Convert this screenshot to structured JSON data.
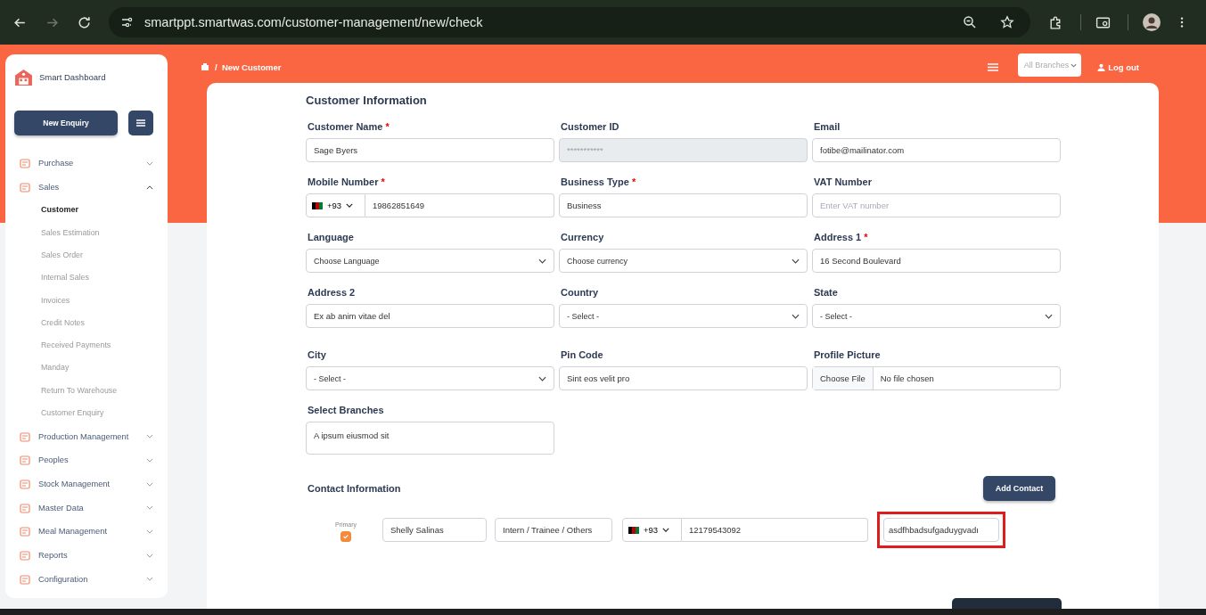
{
  "browser": {
    "url": "smartppt.smartwas.com/customer-management/new/check",
    "forward_disabled": true
  },
  "sidebar": {
    "brand": "Smart Dashboard",
    "primary_button": "New Enquiry",
    "items": [
      {
        "label": "Purchase",
        "expanded": false
      },
      {
        "label": "Sales",
        "expanded": true,
        "children": [
          {
            "label": "Customer",
            "selected": true
          },
          {
            "label": "Sales Estimation",
            "selected": false
          },
          {
            "label": "Sales Order",
            "selected": false
          },
          {
            "label": "Internal Sales",
            "selected": false
          },
          {
            "label": "Invoices",
            "selected": false
          },
          {
            "label": "Credit Notes",
            "selected": false
          },
          {
            "label": "Received Payments",
            "selected": false
          },
          {
            "label": "Manday",
            "selected": false
          },
          {
            "label": "Return To Warehouse",
            "selected": false
          },
          {
            "label": "Customer Enquiry",
            "selected": false
          }
        ]
      },
      {
        "label": "Production Management",
        "expanded": false
      },
      {
        "label": "Peoples",
        "expanded": false
      },
      {
        "label": "Stock Management",
        "expanded": false
      },
      {
        "label": "Master Data",
        "expanded": false
      },
      {
        "label": "Meal Management",
        "expanded": false
      },
      {
        "label": "Reports",
        "expanded": false
      },
      {
        "label": "Configuration",
        "expanded": false
      }
    ]
  },
  "header": {
    "breadcrumb": {
      "separator": "/",
      "page": "New Customer"
    },
    "branch_select": {
      "placeholder": "All Branches"
    },
    "logout": "Log out"
  },
  "form": {
    "title": "Customer Information",
    "required_mark": "*",
    "fields": [
      {
        "label": "Customer Name",
        "required": true,
        "kind": "text",
        "value": "Sage Byers"
      },
      {
        "label": "Customer ID",
        "required": false,
        "kind": "disabled",
        "placeholder": "***********"
      },
      {
        "label": "Email",
        "required": false,
        "kind": "text",
        "value": "fotibe@mailinator.com"
      },
      {
        "label": "Mobile Number",
        "required": true,
        "kind": "phone",
        "code": "+93",
        "value": "19862851649"
      },
      {
        "label": "Business Type",
        "required": true,
        "kind": "text",
        "value": "Business"
      },
      {
        "label": "VAT Number",
        "required": false,
        "kind": "text",
        "placeholder": "Enter VAT number"
      },
      {
        "label": "Language",
        "required": false,
        "kind": "select",
        "value": "Choose Language"
      },
      {
        "label": "Currency",
        "required": false,
        "kind": "select",
        "value": "Choose currency"
      },
      {
        "label": "Address 1",
        "required": true,
        "kind": "text",
        "value": "16 Second Boulevard"
      },
      {
        "label": "Address 2",
        "required": false,
        "kind": "text",
        "value": "Ex ab anim vitae del"
      },
      {
        "label": "Country",
        "required": false,
        "kind": "select",
        "value": "- Select -"
      },
      {
        "label": "State",
        "required": false,
        "kind": "select",
        "value": "- Select -"
      },
      {
        "label": "City",
        "required": false,
        "kind": "select",
        "value": "- Select -"
      },
      {
        "label": "Pin Code",
        "required": false,
        "kind": "text",
        "value": "Sint eos velit pro"
      },
      {
        "label": "Profile Picture",
        "required": false,
        "kind": "file",
        "button": "Choose File",
        "value": "No file chosen"
      },
      {
        "label": "Select Branches",
        "required": false,
        "kind": "tall",
        "value": "A ipsum eiusmod sit"
      }
    ]
  },
  "contacts": {
    "title": "Contact Information",
    "add_button": "Add Contact",
    "rows": [
      {
        "primary_label": "Primary",
        "primary": true,
        "name": "Shelly Salinas",
        "designation": "Intern / Trainee / Others",
        "code": "+93",
        "phone": "12179543092",
        "email": "asdfhbadsufgaduygvadı",
        "highlighted": true
      }
    ]
  }
}
